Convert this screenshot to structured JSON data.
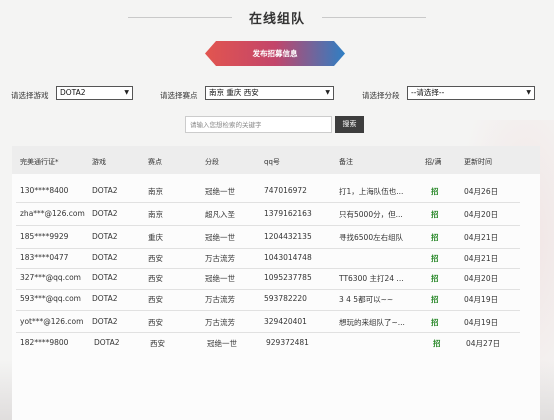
{
  "page": {
    "title": "在线组队",
    "recruit_button": "发布招募信息"
  },
  "filters": {
    "game": {
      "label": "请选择游戏",
      "value": "DOTA2"
    },
    "server": {
      "label": "请选择赛点",
      "value": "南京 重庆 西安"
    },
    "division": {
      "label": "请选择分段",
      "value": "--请选择--"
    }
  },
  "search": {
    "placeholder": "请输入您想检索的关键字",
    "button": "搜索"
  },
  "colors": {
    "button_left": "#e2554f",
    "button_right": "#2e7fc4",
    "recruit_green": "#2d8a2d"
  },
  "table": {
    "columns": [
      "完美通行证*",
      "游戏",
      "赛点",
      "分段",
      "qq号",
      "备注",
      "招/满",
      "更新时间"
    ],
    "rows": [
      {
        "account": "130****8400",
        "game": "DOTA2",
        "server": "南京",
        "division": "冠绝一世",
        "qq": "747016972",
        "note": "打1，上海队伍也...",
        "status": "招",
        "time": "04月26日"
      },
      {
        "account": "zha***@126.com",
        "game": "DOTA2",
        "server": "南京",
        "division": "超凡入圣",
        "qq": "1379162163",
        "note": "只有5000分，但...",
        "status": "招",
        "time": "04月20日"
      },
      {
        "account": "185****9929",
        "game": "DOTA2",
        "server": "重庆",
        "division": "冠绝一世",
        "qq": "1204432135",
        "note": "寻找6500左右组队",
        "status": "招",
        "time": "04月21日"
      },
      {
        "account": "183****0477",
        "game": "DOTA2",
        "server": "西安",
        "division": "万古流芳",
        "qq": "1043014748",
        "note": "",
        "status": "招",
        "time": "04月21日"
      },
      {
        "account": "327***@qq.com",
        "game": "DOTA2",
        "server": "西安",
        "division": "冠绝一世",
        "qq": "1095237785",
        "note": "TT6300 主打24 ...",
        "status": "招",
        "time": "04月20日"
      },
      {
        "account": "593***@qq.com",
        "game": "DOTA2",
        "server": "西安",
        "division": "万古流芳",
        "qq": "593782220",
        "note": "3 4 5都可以~~",
        "status": "招",
        "time": "04月19日"
      },
      {
        "account": "yot***@126.com",
        "game": "DOTA2",
        "server": "西安",
        "division": "万古流芳",
        "qq": "329420401",
        "note": "想玩的来组队了~...",
        "status": "招",
        "time": "04月19日"
      },
      {
        "account": "182****9800",
        "game": "DOTA2",
        "server": "西安",
        "division": "冠绝一世",
        "qq": "929372481",
        "note": "",
        "status": "招",
        "time": "04月27日"
      }
    ]
  }
}
